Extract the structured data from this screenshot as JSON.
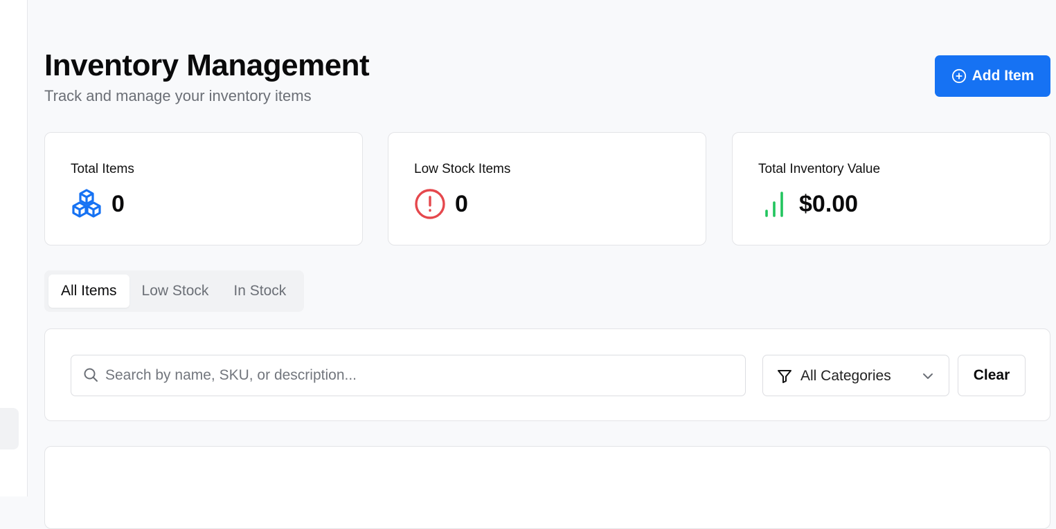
{
  "header": {
    "title": "Inventory Management",
    "subtitle": "Track and manage your inventory items",
    "add_button_label": "Add Item"
  },
  "stats": [
    {
      "label": "Total Items",
      "value": "0",
      "icon": "boxes-icon",
      "color": "#1672f3"
    },
    {
      "label": "Low Stock Items",
      "value": "0",
      "icon": "alert-circle-icon",
      "color": "#e5484d"
    },
    {
      "label": "Total Inventory Value",
      "value": "$0.00",
      "icon": "bar-chart-icon",
      "color": "#22c55e"
    }
  ],
  "tabs": [
    {
      "label": "All Items",
      "active": true
    },
    {
      "label": "Low Stock",
      "active": false
    },
    {
      "label": "In Stock",
      "active": false
    }
  ],
  "filters": {
    "search_placeholder": "Search by name, SKU, or description...",
    "search_value": "",
    "category_selected": "All Categories",
    "clear_label": "Clear"
  },
  "colors": {
    "accent": "#1672f3",
    "background": "#f8f9fb",
    "card_border": "#e3e4e7"
  }
}
